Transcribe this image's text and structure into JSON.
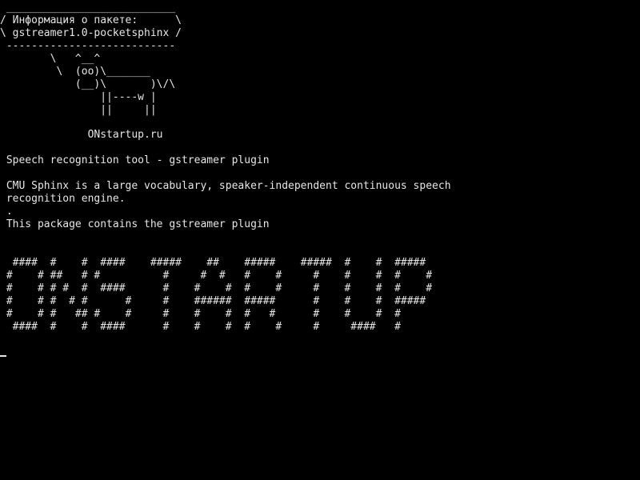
{
  "cowsay": {
    "bubble": " ___________________________\n/ Информация о пакете:      \\\n\\ gstreamer1.0-pocketsphinx /\n ---------------------------\n        \\   ^__^\n         \\  (oo)\\_______\n            (__)\\       )\\/\\\n                ||----w |\n                ||     ||"
  },
  "site": "              ONstartup.ru",
  "summary": " Speech recognition tool - gstreamer plugin",
  "description": " CMU Sphinx is a large vocabulary, speaker-independent continuous speech\n recognition engine.\n .\n This package contains the gstreamer plugin",
  "banner": "  ####  #    #  ####    #####    ##    #####    #####  #    #  #####\n #    # ##   # #          #     #  #   #    #     #    #    #  #    #\n #    # # #  #  ####      #    #    #  #    #     #    #    #  #    #\n #    # #  # #      #     #    ######  #####      #    #    #  #####\n #    # #   ## #    #     #    #    #  #   #      #    #    #  #\n  ####  #    #  ####      #    #    #  #    #     #     ####   #",
  "colors": {
    "background": "#000000",
    "foreground": "#e6e6e6"
  }
}
